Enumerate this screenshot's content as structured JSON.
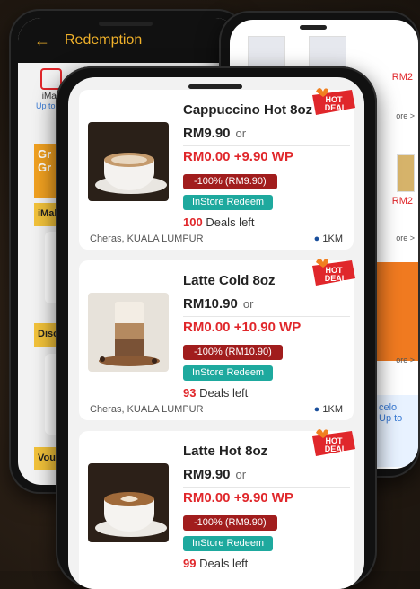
{
  "back_left": {
    "header": {
      "back_icon": "←",
      "title": "Redemption"
    },
    "categories": [
      {
        "label": "iMall",
        "sub": "Up to 78"
      }
    ],
    "banner_text": "Gr\nGr",
    "sections": [
      "iMall",
      "Disc",
      "Vouc"
    ]
  },
  "back_right": {
    "prices": [
      "RM2",
      "RM2"
    ],
    "more": [
      "ore >",
      "ore >",
      "ore >"
    ],
    "chip_text": "celo\nUp to"
  },
  "deals": [
    {
      "name": "Cappuccino Hot 8oz",
      "price": "RM9.90",
      "or": "or",
      "wp": "RM0.00 +9.90 WP",
      "discount": "-100% (RM9.90)",
      "redeem": "InStore Redeem",
      "left_count": "100",
      "left_text": "Deals left",
      "location": "Cheras, KUALA LUMPUR",
      "distance": "1KM",
      "badge": "HOT\nDEAL"
    },
    {
      "name": "Latte Cold 8oz",
      "price": "RM10.90",
      "or": "or",
      "wp": "RM0.00 +10.90 WP",
      "discount": "-100% (RM10.90)",
      "redeem": "InStore Redeem",
      "left_count": "93",
      "left_text": "Deals left",
      "location": "Cheras, KUALA LUMPUR",
      "distance": "1KM",
      "badge": "HOT\nDEAL"
    },
    {
      "name": "Latte Hot 8oz",
      "price": "RM9.90",
      "or": "or",
      "wp": "RM0.00 +9.90 WP",
      "discount": "-100% (RM9.90)",
      "redeem": "InStore Redeem",
      "left_count": "99",
      "left_text": "Deals left",
      "location": "",
      "distance": "",
      "badge": "HOT\nDEAL"
    }
  ]
}
